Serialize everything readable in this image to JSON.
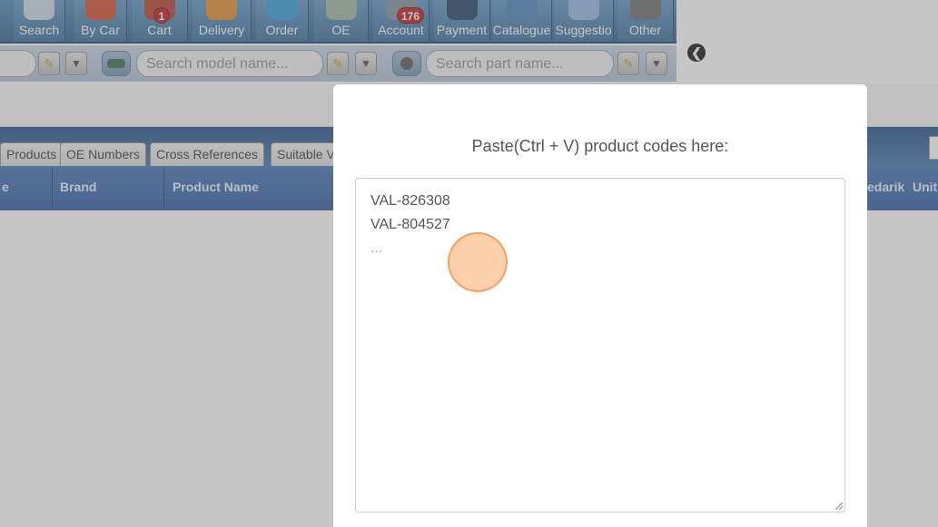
{
  "toolbar": {
    "buttons": [
      {
        "label": "Search",
        "icon": "search-icon"
      },
      {
        "label": "By Car",
        "icon": "car-icon"
      },
      {
        "label": "Cart",
        "icon": "cart-icon",
        "badge": "1"
      },
      {
        "label": "Delivery",
        "icon": "clock-icon"
      },
      {
        "label": "Order",
        "icon": "order-icon"
      },
      {
        "label": "OE",
        "icon": "oe-icon"
      },
      {
        "label": "Account",
        "icon": "account-icon",
        "badge": "176"
      },
      {
        "label": "Payment",
        "icon": "payment-icon"
      },
      {
        "label": "Catalogue",
        "icon": "catalogue-icon"
      },
      {
        "label": "Suggestio",
        "icon": "speech-bubble-icon"
      },
      {
        "label": "Other",
        "icon": "other-icon"
      }
    ]
  },
  "search": {
    "model_placeholder": "Search model name...",
    "part_placeholder": "Search part name..."
  },
  "tabs": [
    "Products",
    "OE Numbers",
    "Cross References",
    "Suitable V"
  ],
  "table": {
    "headers_left": [
      "e",
      "Brand",
      "Product Name"
    ],
    "headers_right": [
      "edarik",
      "Unit"
    ]
  },
  "modal": {
    "title": "Paste(Ctrl + V) product codes here:",
    "codes": [
      "VAL-826308",
      "VAL-804527"
    ],
    "placeholder_more": "..."
  },
  "colors": {
    "toolbar_blue": "#356a9b",
    "header_blue": "#2a57a0",
    "overlay": "#787878",
    "cursor_highlight": "#fcbe8c",
    "badge_red": "#c0161b"
  }
}
